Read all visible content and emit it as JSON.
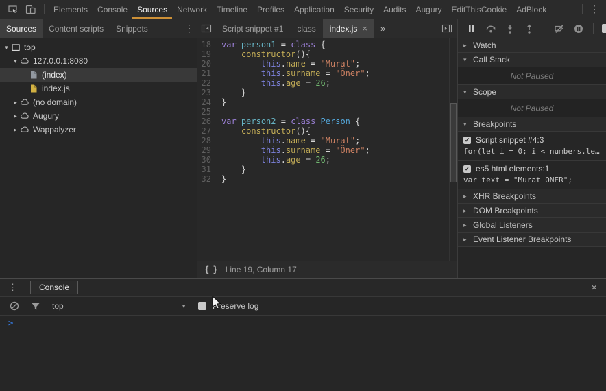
{
  "colors": {
    "accent_orange": "#cd9037",
    "prompt_blue": "#3579de",
    "selected_tab_bg": "#424242",
    "file_icon_yellow": "#d2b142",
    "file_icon_gray": "#9298a0",
    "code_tokens": {
      "keyword": "#9a7fd4",
      "definition": "#66b2c2",
      "class_name": "#54a8dc",
      "property": "#c0aa56",
      "this_keyword": "#7d82dd",
      "string": "#cf8263",
      "number": "#70b56f",
      "plain": "#d4d4d4",
      "line_number": "#5f5f5f"
    }
  },
  "main_toolbar": {
    "tabs": [
      "Elements",
      "Console",
      "Sources",
      "Network",
      "Timeline",
      "Profiles",
      "Application",
      "Security",
      "Audits",
      "Augury",
      "EditThisCookie",
      "AdBlock"
    ],
    "selected": "Sources"
  },
  "left_panel": {
    "tabs": [
      "Sources",
      "Content scripts",
      "Snippets"
    ],
    "selected": "Sources",
    "tree": [
      {
        "label": "top",
        "depth": 0,
        "expander": "expanded",
        "icon": "frame"
      },
      {
        "label": "127.0.0.1:8080",
        "depth": 1,
        "expander": "expanded",
        "icon": "cloud"
      },
      {
        "label": "(index)",
        "depth": 2,
        "expander": "none",
        "icon": "file-gray",
        "selected": true
      },
      {
        "label": "index.js",
        "depth": 2,
        "expander": "none",
        "icon": "file-yellow"
      },
      {
        "label": "(no domain)",
        "depth": 1,
        "expander": "collapsed",
        "icon": "cloud"
      },
      {
        "label": "Augury",
        "depth": 1,
        "expander": "collapsed",
        "icon": "cloud"
      },
      {
        "label": "Wappalyzer",
        "depth": 1,
        "expander": "collapsed",
        "icon": "cloud"
      }
    ]
  },
  "editor": {
    "tabs": [
      {
        "label": "Script snippet #1",
        "selected": false,
        "closable": false
      },
      {
        "label": "class",
        "selected": false,
        "closable": false
      },
      {
        "label": "index.js",
        "selected": true,
        "closable": true
      }
    ],
    "status_text": "Line 19, Column 17",
    "code_lines": [
      {
        "n": 18,
        "segs": [
          [
            "kw",
            "var"
          ],
          [
            "pl",
            " "
          ],
          [
            "def",
            "person1"
          ],
          [
            "pl",
            " = "
          ],
          [
            "kw",
            "class"
          ],
          [
            "pl",
            " {"
          ]
        ]
      },
      {
        "n": 19,
        "segs": [
          [
            "pl",
            "    "
          ],
          [
            "prop",
            "constructor"
          ],
          [
            "pl",
            "(){"
          ]
        ]
      },
      {
        "n": 20,
        "segs": [
          [
            "pl",
            "        "
          ],
          [
            "ths",
            "this"
          ],
          [
            "pl",
            "."
          ],
          [
            "prop",
            "name"
          ],
          [
            "pl",
            " = "
          ],
          [
            "str",
            "\"Murat\""
          ],
          [
            "pl",
            ";"
          ]
        ]
      },
      {
        "n": 21,
        "segs": [
          [
            "pl",
            "        "
          ],
          [
            "ths",
            "this"
          ],
          [
            "pl",
            "."
          ],
          [
            "prop",
            "surname"
          ],
          [
            "pl",
            " = "
          ],
          [
            "str",
            "\"Öner\""
          ],
          [
            "pl",
            ";"
          ]
        ]
      },
      {
        "n": 22,
        "segs": [
          [
            "pl",
            "        "
          ],
          [
            "ths",
            "this"
          ],
          [
            "pl",
            "."
          ],
          [
            "prop",
            "age"
          ],
          [
            "pl",
            " = "
          ],
          [
            "num",
            "26"
          ],
          [
            "pl",
            ";"
          ]
        ]
      },
      {
        "n": 23,
        "segs": [
          [
            "pl",
            "    }"
          ]
        ]
      },
      {
        "n": 24,
        "segs": [
          [
            "pl",
            "}"
          ]
        ]
      },
      {
        "n": 25,
        "segs": []
      },
      {
        "n": 26,
        "segs": [
          [
            "kw",
            "var"
          ],
          [
            "pl",
            " "
          ],
          [
            "def",
            "person2"
          ],
          [
            "pl",
            " = "
          ],
          [
            "kw",
            "class"
          ],
          [
            "pl",
            " "
          ],
          [
            "typ",
            "Person"
          ],
          [
            "pl",
            " {"
          ]
        ]
      },
      {
        "n": 27,
        "segs": [
          [
            "pl",
            "    "
          ],
          [
            "prop",
            "constructor"
          ],
          [
            "pl",
            "(){"
          ]
        ]
      },
      {
        "n": 28,
        "segs": [
          [
            "pl",
            "        "
          ],
          [
            "ths",
            "this"
          ],
          [
            "pl",
            "."
          ],
          [
            "prop",
            "name"
          ],
          [
            "pl",
            " = "
          ],
          [
            "str",
            "\"Murat\""
          ],
          [
            "pl",
            ";"
          ]
        ]
      },
      {
        "n": 29,
        "segs": [
          [
            "pl",
            "        "
          ],
          [
            "ths",
            "this"
          ],
          [
            "pl",
            "."
          ],
          [
            "prop",
            "surname"
          ],
          [
            "pl",
            " = "
          ],
          [
            "str",
            "\"Öner\""
          ],
          [
            "pl",
            ";"
          ]
        ]
      },
      {
        "n": 30,
        "segs": [
          [
            "pl",
            "        "
          ],
          [
            "ths",
            "this"
          ],
          [
            "pl",
            "."
          ],
          [
            "prop",
            "age"
          ],
          [
            "pl",
            " = "
          ],
          [
            "num",
            "26"
          ],
          [
            "pl",
            ";"
          ]
        ]
      },
      {
        "n": 31,
        "segs": [
          [
            "pl",
            "    }"
          ]
        ]
      },
      {
        "n": 32,
        "segs": [
          [
            "pl",
            "}"
          ]
        ]
      }
    ]
  },
  "right_panel": {
    "sections": [
      {
        "kind": "header",
        "label": "Watch",
        "expanded": false
      },
      {
        "kind": "header",
        "label": "Call Stack",
        "expanded": true
      },
      {
        "kind": "info",
        "label": "Not Paused"
      },
      {
        "kind": "header",
        "label": "Scope",
        "expanded": true
      },
      {
        "kind": "info",
        "label": "Not Paused"
      },
      {
        "kind": "header",
        "label": "Breakpoints",
        "expanded": true
      },
      {
        "kind": "breakpoint",
        "checked": true,
        "label": "Script snippet #4:3",
        "code": "for(let i = 0; i < numbers.le…"
      },
      {
        "kind": "breakpoint",
        "checked": true,
        "label": "es5 html elements:1",
        "code": "var text = \"Murat ÖNER\";"
      },
      {
        "kind": "header",
        "label": "XHR Breakpoints",
        "expanded": false
      },
      {
        "kind": "header",
        "label": "DOM Breakpoints",
        "expanded": false
      },
      {
        "kind": "header",
        "label": "Global Listeners",
        "expanded": false
      },
      {
        "kind": "header",
        "label": "Event Listener Breakpoints",
        "expanded": false
      }
    ]
  },
  "console": {
    "tab_label": "Console",
    "frame_label": "top",
    "preserve_log_label": "Preserve log",
    "preserve_log_checked": false,
    "prompt_char": ">"
  },
  "icons": {
    "overflow": "⋮",
    "close": "×",
    "more_tabs": "»",
    "dropdown": "▼",
    "expanded": "▾",
    "collapsed": "▸",
    "pretty_print": "{ }"
  }
}
